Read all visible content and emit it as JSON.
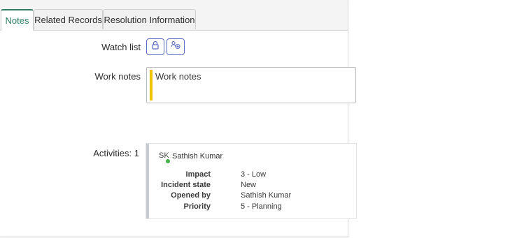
{
  "tabs": [
    {
      "label": "Notes",
      "active": true
    },
    {
      "label": "Related Records",
      "active": false
    },
    {
      "label": "Resolution Information",
      "active": false
    }
  ],
  "watch_list": {
    "label": "Watch list",
    "lock_icon": "lock-icon",
    "add_me_icon": "add-user-icon"
  },
  "work_notes": {
    "label": "Work notes",
    "placeholder": "Work notes",
    "accent_color": "#f5c400"
  },
  "activities": {
    "label": "Activities: 1",
    "entry": {
      "initials": "SK",
      "author": "Sathish Kumar",
      "fields": [
        {
          "key": "Impact",
          "value": "3 - Low"
        },
        {
          "key": "Incident state",
          "value": "New"
        },
        {
          "key": "Opened by",
          "value": "Sathish Kumar"
        },
        {
          "key": "Priority",
          "value": "5 - Planning"
        }
      ]
    }
  },
  "colors": {
    "active_tab": "#2e7d62",
    "button_border": "#5a6bc4",
    "presence": "#41b34a"
  }
}
